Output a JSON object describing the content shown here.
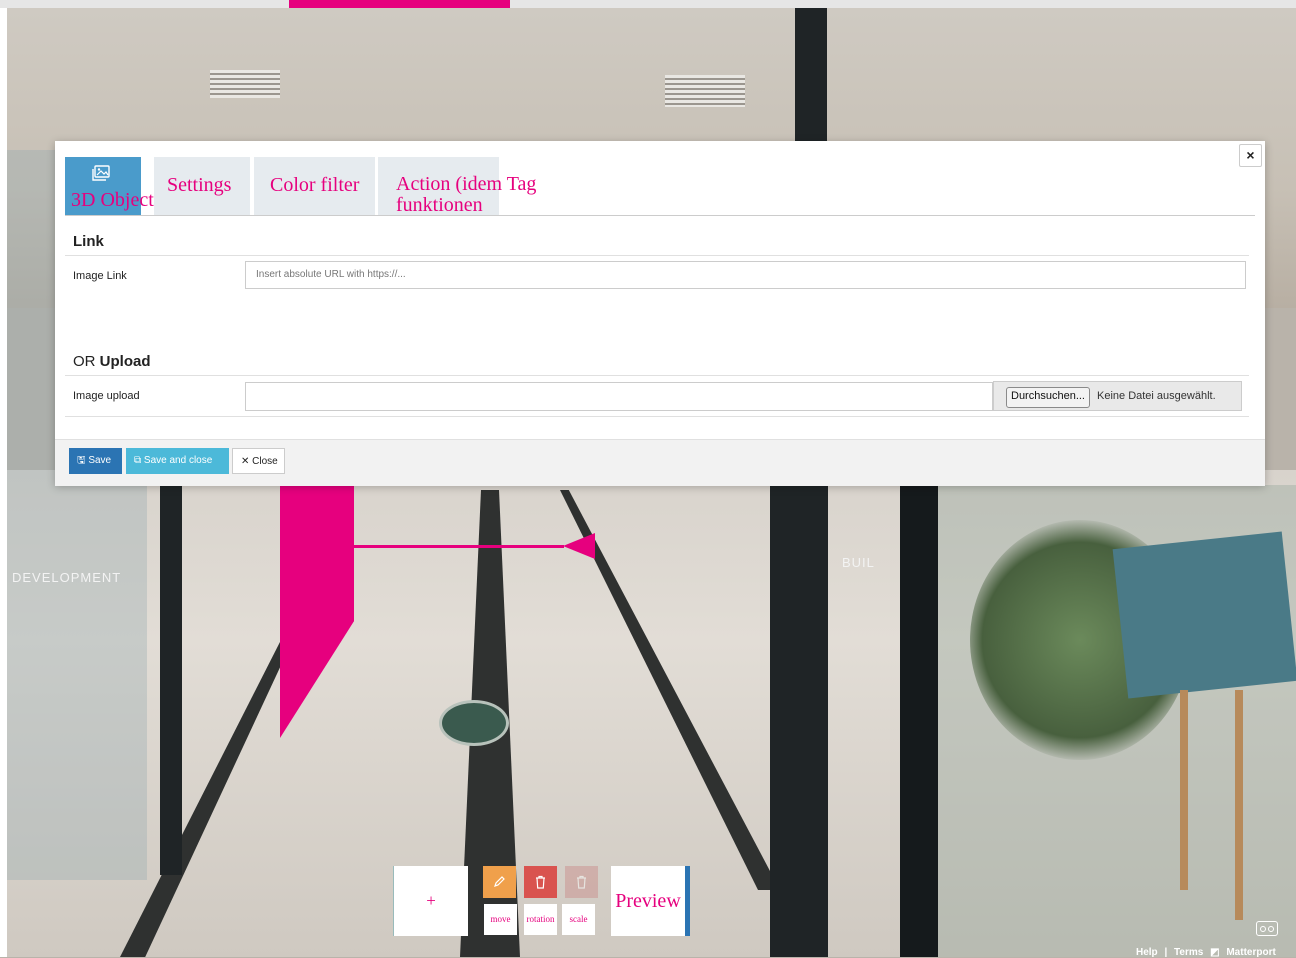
{
  "modal": {
    "tabs": [
      {
        "label": "3D Object",
        "icon": "image-icon",
        "active": true
      },
      {
        "label": "Settings"
      },
      {
        "label": "Color filter"
      },
      {
        "label_line1": "Action (idem Tag",
        "label_line2": "funktionen"
      }
    ],
    "link_section": {
      "title": "Link"
    },
    "image_link": {
      "label": "Image Link",
      "placeholder": "Insert absolute URL with https://..."
    },
    "upload_section": {
      "title_prefix": "OR",
      "title_bold": "Upload"
    },
    "image_upload": {
      "label": "Image upload",
      "browse_label": "Durchsuchen...",
      "no_file_text": "Keine Datei ausgewählt."
    },
    "footer": {
      "save": "Save",
      "save_and_close": "Save and close",
      "close": "Close"
    },
    "close_icon": "×"
  },
  "toolbar": {
    "add": "+",
    "move": "move",
    "rotation": "rotation",
    "scale": "scale",
    "preview": "Preview"
  },
  "bottom_links": {
    "help": "Help",
    "separator": "|",
    "terms": "Terms",
    "brand": "Matterport"
  },
  "scene": {
    "wall_text_left": "DEVELOPMENT",
    "wall_text_right": "BUIL"
  },
  "colors": {
    "accent": "#e6007e",
    "tab_active": "#4a9bcb",
    "save": "#2b74b3",
    "save_close": "#4cb9d9",
    "edit": "#f0a04b",
    "delete": "#d9534f"
  }
}
